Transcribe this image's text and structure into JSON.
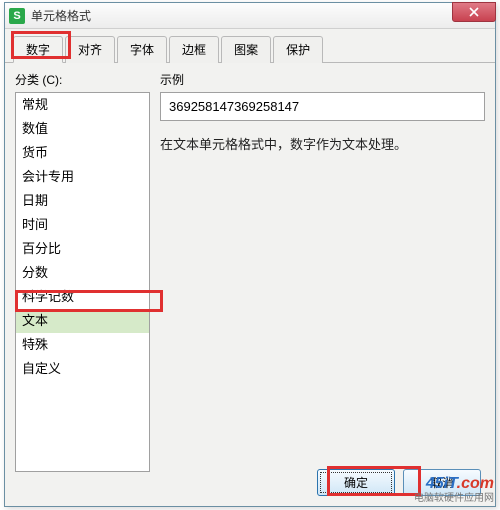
{
  "window": {
    "title": "单元格格式",
    "app_icon_letter": "S"
  },
  "tabs": {
    "items": [
      {
        "label": "数字"
      },
      {
        "label": "对齐"
      },
      {
        "label": "字体"
      },
      {
        "label": "边框"
      },
      {
        "label": "图案"
      },
      {
        "label": "保护"
      }
    ],
    "active_index": 0
  },
  "category": {
    "label": "分类 (C):",
    "items": [
      "常规",
      "数值",
      "货币",
      "会计专用",
      "日期",
      "时间",
      "百分比",
      "分数",
      "科学记数",
      "文本",
      "特殊",
      "自定义"
    ],
    "selected_index": 9
  },
  "sample": {
    "label": "示例",
    "value": "369258147369258147"
  },
  "description": "在文本单元格格式中，数字作为文本处理。",
  "buttons": {
    "ok": "确定",
    "cancel": "取消"
  },
  "watermark": {
    "brand_left": "45iT",
    "brand_right": ".com",
    "tagline": "电脑软硬件应用网"
  }
}
